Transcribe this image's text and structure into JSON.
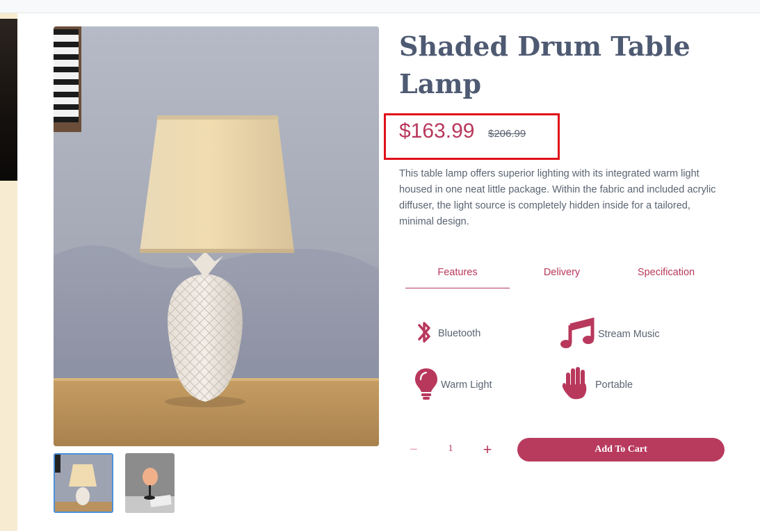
{
  "product": {
    "title": "Shaded Drum Table Lamp",
    "price": "$163.99",
    "old_price": "$206.99",
    "description": "This table lamp offers superior lighting with its integrated warm light housed in one neat little package. Within the fabric and included acrylic diffuser, the light source is completely hidden inside for a tailored, minimal design."
  },
  "tabs": [
    {
      "label": "Features",
      "active": true
    },
    {
      "label": "Delivery",
      "active": false
    },
    {
      "label": "Specification",
      "active": false
    }
  ],
  "features": [
    {
      "label": "Bluetooth",
      "icon": "bluetooth-icon"
    },
    {
      "label": "Stream Music",
      "icon": "music-icon"
    },
    {
      "label": "Warm Light",
      "icon": "lightbulb-icon"
    },
    {
      "label": "Portable",
      "icon": "hand-icon"
    }
  ],
  "cart": {
    "quantity": "1",
    "minus": "−",
    "plus": "+",
    "add_label": "Add To Cart"
  },
  "colors": {
    "accent": "#b8385c",
    "title": "#4e5a72",
    "highlight_box": "#e0101a"
  }
}
